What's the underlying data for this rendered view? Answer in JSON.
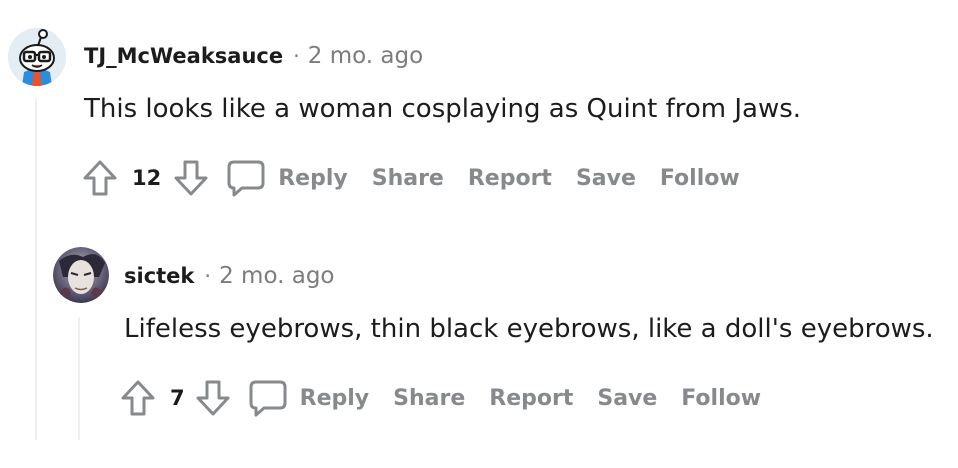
{
  "comments": [
    {
      "username": "TJ_McWeaksauce",
      "separator": "·",
      "time": "2 mo. ago",
      "body": "This looks like a woman cosplaying as Quint from Jaws.",
      "votes": "12",
      "actions": {
        "reply": "Reply",
        "share": "Share",
        "report": "Report",
        "save": "Save",
        "follow": "Follow"
      }
    },
    {
      "username": "sictek",
      "separator": "·",
      "time": "2 mo. ago",
      "body": "Lifeless eyebrows, thin black eyebrows, like a doll's eyebrows.",
      "votes": "7",
      "actions": {
        "reply": "Reply",
        "share": "Share",
        "report": "Report",
        "save": "Save",
        "follow": "Follow"
      }
    }
  ],
  "colors": {
    "text": "#1c1c1c",
    "meta": "#7c7c7c",
    "action": "#878a8c",
    "thread": "#edeff1"
  }
}
